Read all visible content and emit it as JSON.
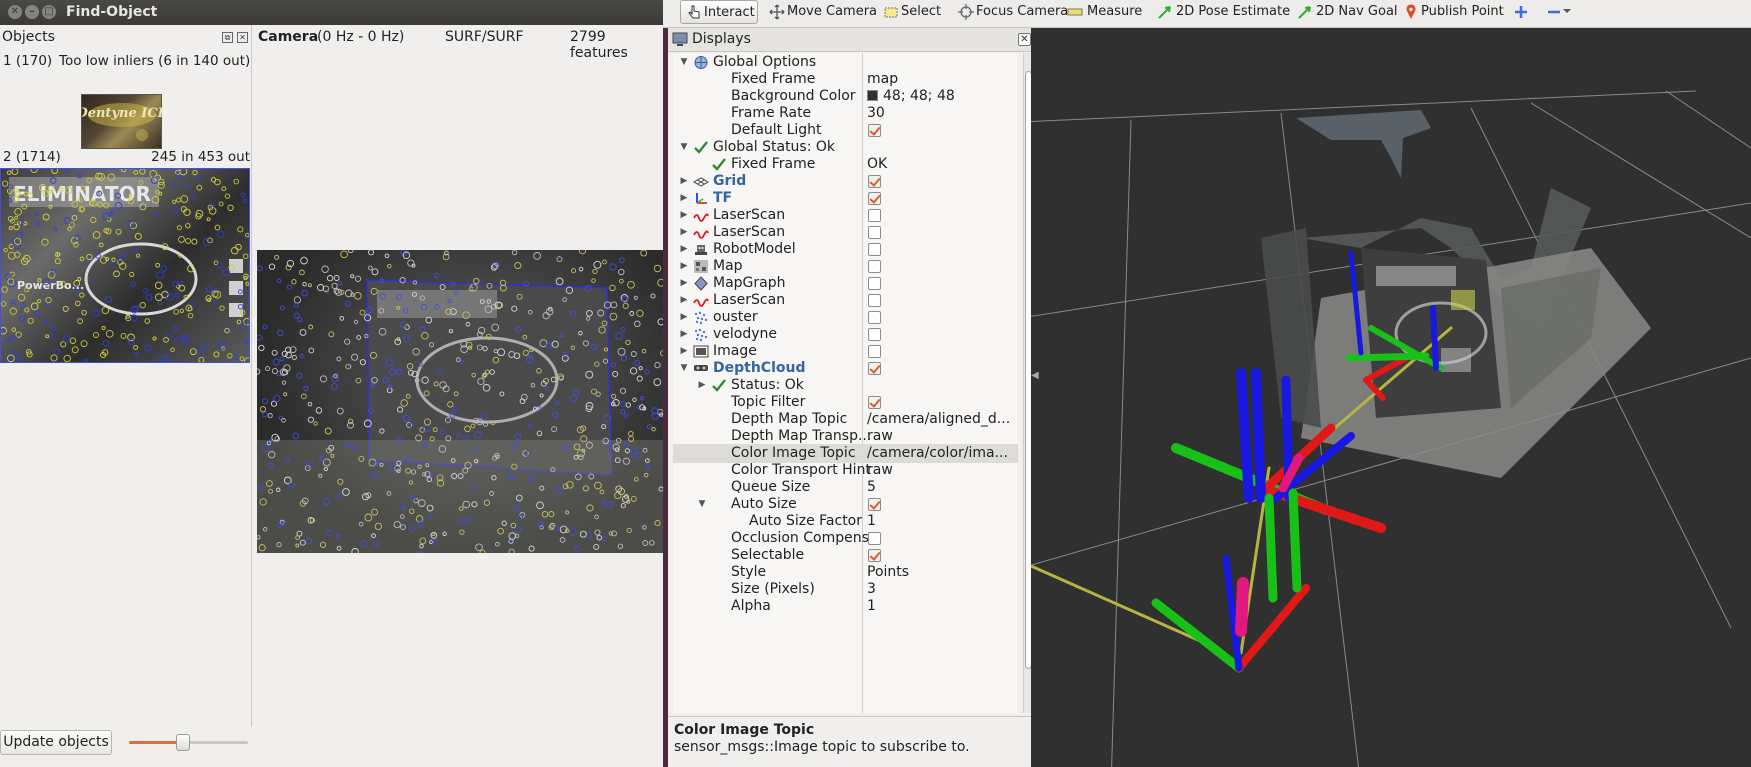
{
  "find_object": {
    "title": "Find-Object",
    "objects_header": "Objects",
    "objects": [
      {
        "id_label": "1 (170)",
        "status": "Too low inliers (6 in 140 out)"
      },
      {
        "id_label": "2 (1714)",
        "status": "245 in 453 out"
      }
    ],
    "camera": {
      "label": "Camera",
      "rate": "(0 Hz - 0 Hz)",
      "detector": "SURF/SURF",
      "features": "2799 features"
    },
    "update_button": "Update objects",
    "slider_value_fraction": 0.45,
    "thumbnail_texts": {
      "obj1": "Dentyne ICE",
      "obj2": "ELIMINATOR",
      "obj2_sub": "PowerBo..."
    }
  },
  "rviz": {
    "toolbar": [
      {
        "label": "Interact",
        "icon": "hand-pointer-icon"
      },
      {
        "label": "Move Camera",
        "icon": "move-camera-icon"
      },
      {
        "label": "Select",
        "icon": "select-box-icon"
      },
      {
        "label": "Focus Camera",
        "icon": "focus-camera-icon"
      },
      {
        "label": "Measure",
        "icon": "ruler-icon"
      },
      {
        "label": "2D Pose Estimate",
        "icon": "green-arrow-icon"
      },
      {
        "label": "2D Nav Goal",
        "icon": "green-arrow-icon"
      },
      {
        "label": "Publish Point",
        "icon": "map-pin-icon"
      }
    ],
    "displays_title": "Displays",
    "tree": [
      {
        "name": "Global Options",
        "indent": 0,
        "arrow": "down",
        "icon": "globe-icon"
      },
      {
        "name": "Fixed Frame",
        "indent": 1,
        "value": "map"
      },
      {
        "name": "Background Color",
        "indent": 1,
        "value": "48; 48; 48",
        "swatch": "#303030"
      },
      {
        "name": "Frame Rate",
        "indent": 1,
        "value": "30"
      },
      {
        "name": "Default Light",
        "indent": 1,
        "check": true
      },
      {
        "name": "Global Status: Ok",
        "indent": 0,
        "arrow": "down",
        "icon": "checkmark-icon"
      },
      {
        "name": "Fixed Frame",
        "indent": 1,
        "value": "OK",
        "icon": "checkmark-icon"
      },
      {
        "name": "Grid",
        "indent": 0,
        "arrow": "right",
        "icon": "grid-icon",
        "check": true,
        "blue": true
      },
      {
        "name": "TF",
        "indent": 0,
        "arrow": "right",
        "icon": "tf-icon",
        "check": true,
        "blue": true
      },
      {
        "name": "LaserScan",
        "indent": 0,
        "arrow": "right",
        "icon": "laserscan-icon",
        "check": false
      },
      {
        "name": "LaserScan",
        "indent": 0,
        "arrow": "right",
        "icon": "laserscan-icon",
        "check": false
      },
      {
        "name": "RobotModel",
        "indent": 0,
        "arrow": "right",
        "icon": "robot-icon",
        "check": false
      },
      {
        "name": "Map",
        "indent": 0,
        "arrow": "right",
        "icon": "map-icon",
        "check": false
      },
      {
        "name": "MapGraph",
        "indent": 0,
        "arrow": "right",
        "icon": "diamond-icon",
        "check": false
      },
      {
        "name": "LaserScan",
        "indent": 0,
        "arrow": "right",
        "icon": "laserscan-icon",
        "check": false
      },
      {
        "name": "ouster",
        "indent": 0,
        "arrow": "right",
        "icon": "pointcloud-icon",
        "check": false
      },
      {
        "name": "velodyne",
        "indent": 0,
        "arrow": "right",
        "icon": "pointcloud-icon",
        "check": false
      },
      {
        "name": "Image",
        "indent": 0,
        "arrow": "right",
        "icon": "image-icon",
        "check": false
      },
      {
        "name": "DepthCloud",
        "indent": 0,
        "arrow": "down",
        "icon": "depthcloud-icon",
        "check": true,
        "blue": true
      },
      {
        "name": "Status: Ok",
        "indent": 1,
        "arrow": "right",
        "icon": "checkmark-icon"
      },
      {
        "name": "Topic Filter",
        "indent": 1,
        "check": true
      },
      {
        "name": "Depth Map Topic",
        "indent": 1,
        "value": "/camera/aligned_d..."
      },
      {
        "name": "Depth Map Transp...",
        "indent": 1,
        "value": "raw"
      },
      {
        "name": "Color Image Topic",
        "indent": 1,
        "value": "/camera/color/ima...",
        "selected": true
      },
      {
        "name": "Color Transport Hint",
        "indent": 1,
        "value": "raw"
      },
      {
        "name": "Queue Size",
        "indent": 1,
        "value": "5"
      },
      {
        "name": "Auto Size",
        "indent": 1,
        "arrow": "down",
        "check": true
      },
      {
        "name": "Auto Size Factor",
        "indent": 2,
        "value": "1"
      },
      {
        "name": "Occlusion Compens...",
        "indent": 1,
        "check": false
      },
      {
        "name": "Selectable",
        "indent": 1,
        "check": true
      },
      {
        "name": "Style",
        "indent": 1,
        "value": "Points"
      },
      {
        "name": "Size (Pixels)",
        "indent": 1,
        "value": "3"
      },
      {
        "name": "Alpha",
        "indent": 1,
        "value": "1"
      }
    ],
    "description_title": "Color Image Topic",
    "description_text": "sensor_msgs::Image topic to subscribe to."
  },
  "colors": {
    "accent_orange": "#e2592a",
    "rviz_bg": "#303030",
    "tf_red": "#e01818",
    "tf_green": "#18c018",
    "tf_blue": "#1818e0"
  }
}
